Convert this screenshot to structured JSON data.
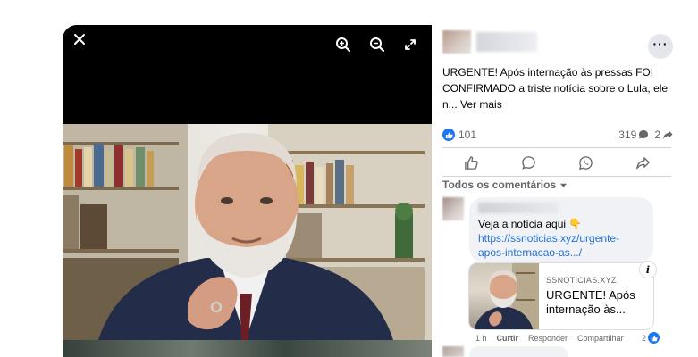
{
  "viewer": {
    "close_icon": "close-icon",
    "zoom_in_icon": "zoom-in-icon",
    "zoom_out_icon": "zoom-out-icon",
    "fullscreen_icon": "fullscreen-icon"
  },
  "post": {
    "text": "URGENTE! Após internação às pressas FOI CONFIRMADO a triste notícia sobre o Lula, ele n...",
    "see_more": "Ver mais",
    "likes": "101",
    "comments": "319",
    "shares": "2"
  },
  "comments_section": {
    "sort_label": "Todos os comentários",
    "comment": {
      "text": "Veja a notícia aqui 👇",
      "link": "https://ssnoticias.xyz/urgente-apos-internacao-as.../",
      "preview": {
        "domain": "SSNOTICIAS.XYZ",
        "title": "URGENTE! Após internação às..."
      },
      "time": "1 h",
      "like_label": "Curtir",
      "reply_label": "Responder",
      "share_label": "Compartilhar",
      "reaction_count": "2"
    }
  },
  "colors": {
    "accent": "#1877f2",
    "link": "#216fdb",
    "muted_text": "#65676b",
    "bubble_bg": "#f0f2f5"
  }
}
